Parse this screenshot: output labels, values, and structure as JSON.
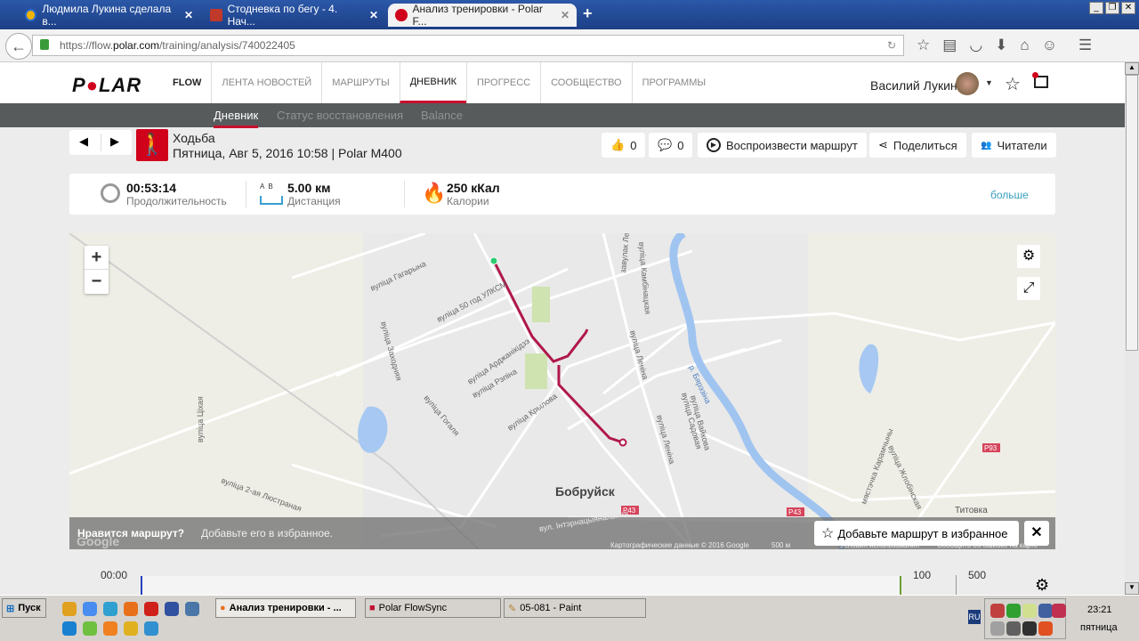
{
  "browser": {
    "tabs": [
      {
        "title": "Людмила Лукина сделала в..."
      },
      {
        "title": "Стодневка по бегу - 4. Нач..."
      },
      {
        "title": "Анализ тренировки - Polar F..."
      }
    ],
    "url_prefix": "https://flow.",
    "url_host": "polar.com",
    "url_path": "/training/analysis/740022405"
  },
  "header": {
    "logo": "POLAR",
    "flow": "FLOW",
    "nav": [
      "ЛЕНТА НОВОСТЕЙ",
      "МАРШРУТЫ",
      "ДНЕВНИК",
      "ПРОГРЕСС",
      "СООБЩЕСТВО",
      "ПРОГРАММЫ"
    ],
    "user": "Василий Лукин"
  },
  "subnav": [
    "Дневник",
    "Статус восстановления",
    "Balance"
  ],
  "session": {
    "sport": "Ходьба",
    "meta": "Пятница, Авг 5, 2016 10:58 | Polar M400"
  },
  "actions": {
    "likes": "0",
    "comments": "0",
    "replay": "Воспроизвести маршрут",
    "share": "Поделиться",
    "followers": "Читатели"
  },
  "stats": {
    "duration": "00:53:14",
    "duration_label": "Продолжительность",
    "distance": "5.00 км",
    "distance_label": "Дистанция",
    "ab": "A  B",
    "calories": "250 кКал",
    "calories_label": "Калории",
    "more": "больше"
  },
  "map": {
    "city": "Бобруйск",
    "village": "Титовка",
    "river": "р. Бярэзіна",
    "roads": [
      "P43",
      "P43",
      "P93"
    ],
    "streets": [
      "вуліца Гагарына",
      "вуліца 50 год УЛКСМ",
      "вуліца Заходняя",
      "вуліца Арджанікідзэ",
      "вуліца Рэпіна",
      "вуліца Крылова",
      "вуліца Гогаля",
      "вуліца Цiхая",
      "вуліца 2-ая Люстраная",
      "вуліца Леніна",
      "вуліца Леніна",
      "вуліца Вайкова",
      "вуліца Садовая",
      "вуліца Камбінацкая",
      "завулак Леніна",
      "вуліца Жлобінская",
      "мястэчка Карамчыны",
      "вул. Інтэрнацыянальная"
    ],
    "attribution": "Картографические данные © 2016 Google",
    "scale": "500 м",
    "terms": "Условия использования",
    "report": "Сообщить об ошибке на карте",
    "google": "Google",
    "fav_question": "Нравится маршрут?",
    "fav_hint": "Добавьте его в избранное.",
    "fav_button": "Добавьте маршрут в избранное"
  },
  "timeline": {
    "start": "00:00",
    "mark1": "100",
    "mark2": "500"
  },
  "taskbar": {
    "start": "Пуск",
    "windows": [
      "Анализ тренировки - ...",
      "Polar FlowSync",
      "05-081 - Paint"
    ],
    "lang": "RU",
    "time": "23:21",
    "day": "пятница"
  }
}
